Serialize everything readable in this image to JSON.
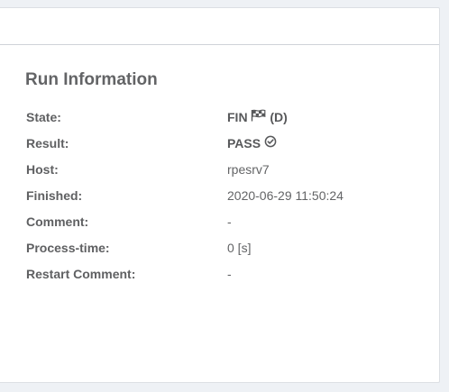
{
  "panel": {
    "title": "Run Information"
  },
  "rows": [
    {
      "label": "State:",
      "value": "FIN",
      "suffix": "(D)",
      "icon": "flag-checkered-icon"
    },
    {
      "label": "Result:",
      "value": "PASS",
      "icon": "check-circle-icon"
    },
    {
      "label": "Host:",
      "value": "rpesrv7"
    },
    {
      "label": "Finished:",
      "value": "2020-06-29 11:50:24"
    },
    {
      "label": "Comment:",
      "value": "-"
    },
    {
      "label": "Process-time:",
      "value": "0 [s]"
    },
    {
      "label": "Restart Comment:",
      "value": "-"
    }
  ]
}
